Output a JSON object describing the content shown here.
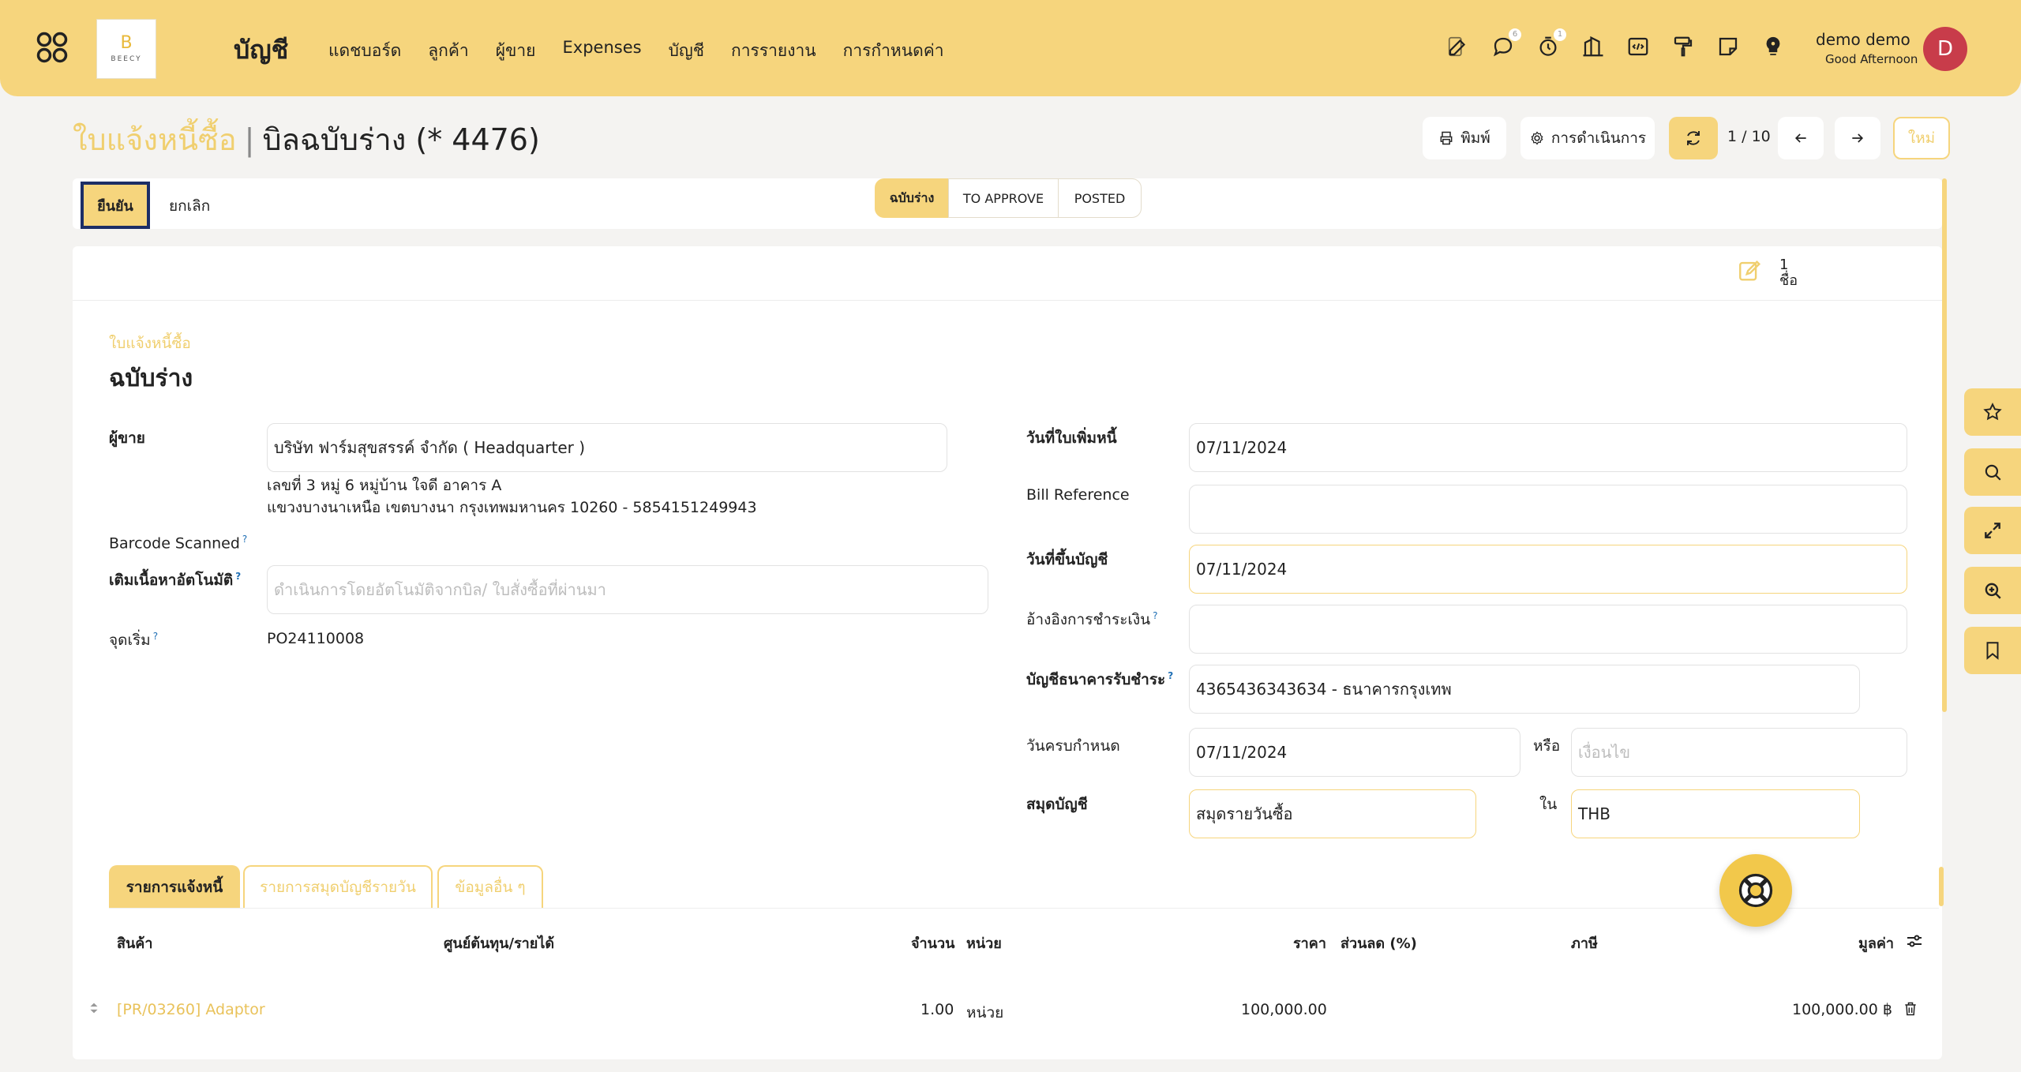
{
  "navbar": {
    "logo_text": "BEECY",
    "app_title": "บัญชี",
    "menu": [
      "แดชบอร์ด",
      "ลูกค้า",
      "ผู้ขาย",
      "Expenses",
      "บัญชี",
      "การรายงาน",
      "การกำหนดค่า"
    ],
    "icons": [
      "edit-icon",
      "chat-icon",
      "timer-icon",
      "building-icon",
      "code-icon",
      "paint-roller-icon",
      "sticky-note-icon",
      "lightbulb-icon"
    ],
    "chat_badge": "6",
    "timer_badge": "1",
    "user_name": "demo demo",
    "greeting": "Good Afternoon",
    "avatar_letter": "D"
  },
  "breadcrumb": {
    "parent": "ใบแจ้งหนี้ซื้อ",
    "current": "บิลฉบับร่าง (* 4476)"
  },
  "controls": {
    "print_label": "พิมพ์",
    "action_label": "การดำเนินการ",
    "pager": "1 / 10",
    "new_label": "ใหม่"
  },
  "statusbar": {
    "confirm_label": "ยืนยัน",
    "cancel_label": "ยกเลิก",
    "stages": [
      "ฉบับร่าง",
      "TO APPROVE",
      "POSTED"
    ],
    "active_stage": "ฉบับร่าง"
  },
  "chatter": {
    "count": "1",
    "label": "ชื่อ"
  },
  "form": {
    "doc_type": "ใบแจ้งหนี้ซื้อ",
    "doc_name": "ฉบับร่าง",
    "vendor_label": "ผู้ขาย",
    "vendor_value": "บริษัท ฟาร์มสุขสรรค์ จำกัด ( Headquarter )",
    "vendor_address_1": "เลขที่ 3 หมู่ 6 หมู่บ้าน ใจดี อาคาร A",
    "vendor_address_2": "แขวงบางนาเหนือ เขตบางนา กรุงเทพมหานคร 10260 - 5854151249943",
    "barcode_label": "Barcode Scanned",
    "autocomplete_label": "เติมเนื้อหาอัตโนมัติ",
    "autocomplete_placeholder": "ดำเนินการโดยอัตโนมัติจากบิล/ ใบสั่งซื้อที่ผ่านมา",
    "source_label": "จุดเริ่ม",
    "source_value": "PO24110008",
    "bill_date_label": "วันที่ใบเพิ่มหนี้",
    "bill_date_value": "07/11/2024",
    "bill_ref_label": "Bill Reference",
    "bill_ref_value": "",
    "acc_date_label": "วันที่ขึ้นบัญชี",
    "acc_date_value": "07/11/2024",
    "payment_ref_label": "อ้างอิงการชำระเงิน",
    "payment_ref_value": "",
    "bank_label": "บัญชีธนาคารรับชำระ",
    "bank_value": "4365436343634 - ธนาคารกรุงเทพ",
    "due_label": "วันครบกำหนด",
    "due_value": "07/11/2024",
    "or_label": "หรือ",
    "terms_placeholder": "เงื่อนไข",
    "journal_label": "สมุดบัญชี",
    "journal_value": "สมุดรายวันซื้อ",
    "in_label": "ใน",
    "currency_value": "THB"
  },
  "tabs": [
    "รายการแจ้งหนี้",
    "รายการสมุดบัญชีรายวัน",
    "ข้อมูลอื่น ๆ"
  ],
  "lines": {
    "headers": {
      "product": "สินค้า",
      "analytic": "ศูนย์ต้นทุน/รายได้",
      "qty": "จำนวน",
      "uom": "หน่วย",
      "price": "ราคา",
      "discount": "ส่วนลด (%)",
      "tax": "ภาษี",
      "subtotal": "มูลค่า"
    },
    "rows": [
      {
        "product": "[PR/03260] Adaptor",
        "qty": "1.00",
        "uom": "หน่วย",
        "price": "100,000.00",
        "subtotal": "100,000.00 ฿"
      }
    ]
  },
  "side_tools": [
    "star-icon",
    "search-icon",
    "expand-icon",
    "zoom-in-icon",
    "bookmark-icon"
  ],
  "colors": {
    "brand": "#f6d57d",
    "brand_text": "#f0cf6f",
    "focus_border": "#1c2e66",
    "avatar": "#c83c4a"
  }
}
